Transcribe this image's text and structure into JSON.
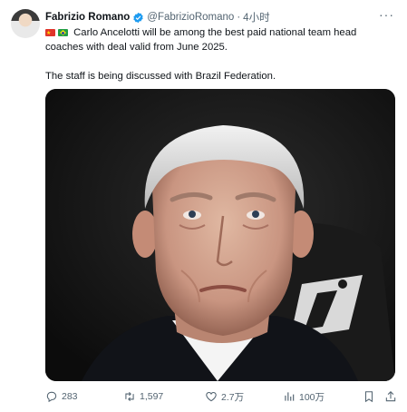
{
  "author": {
    "name": "Fabrizio Romano",
    "handle": "@FabrizioRomano",
    "separator": "·",
    "time": "4小时",
    "more": "···"
  },
  "tweet": {
    "line1": "Carlo Ancelotti will be among the best paid national team head",
    "line2": "coaches with deal valid from June 2025.",
    "line3": "The staff is being discussed with Brazil Federation."
  },
  "stats": {
    "replies": "283",
    "retweets": "1,597",
    "likes": "2.7万",
    "views": "100万"
  },
  "colors": {
    "text": "#0f1419",
    "muted": "#536471",
    "verified": "#1d9bf0"
  },
  "icons": [
    "verified-badge-icon",
    "china-flag-icon",
    "brazil-flag-icon",
    "reply-icon",
    "retweet-icon",
    "like-icon",
    "views-icon",
    "bookmark-icon",
    "share-icon"
  ]
}
